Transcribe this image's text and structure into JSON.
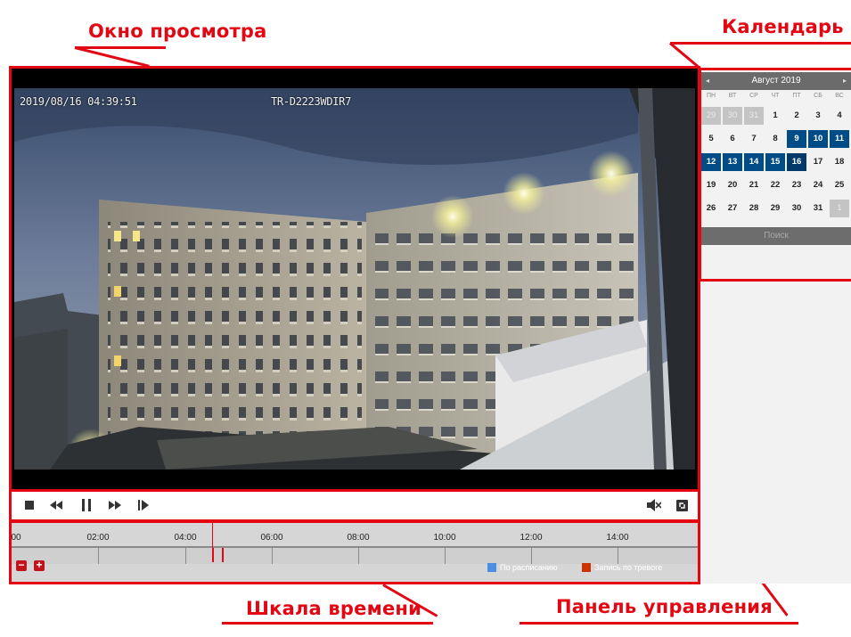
{
  "annotations": {
    "viewer": "Окно просмотра",
    "calendar": "Календарь",
    "timeline": "Шкала времени",
    "control_panel": "Панель управления"
  },
  "video": {
    "timestamp": "2019/08/16 04:39:51",
    "camera_name": "TR-D2223WDIR7"
  },
  "controls": {
    "buttons": [
      "stop-icon",
      "rewind-icon",
      "pause-icon",
      "fast-forward-icon",
      "step-forward-icon"
    ],
    "right_buttons": [
      "mute-icon",
      "fullscreen-icon"
    ]
  },
  "timeline": {
    "ticks": [
      "00",
      "02:00",
      "04:00",
      "06:00",
      "08:00",
      "10:00",
      "12:00",
      "14:00"
    ],
    "zoom_out": "−",
    "zoom_in": "+",
    "legend": [
      {
        "label": "По расписанию",
        "color": "#4a90e2"
      },
      {
        "label": "Запись по тревоге",
        "color": "#cc3300"
      }
    ],
    "cursor_color": "#e30613"
  },
  "calendar": {
    "month": "Август 2019",
    "prev": "◂",
    "next": "▸",
    "weekdays": [
      "ПН",
      "ВТ",
      "СР",
      "ЧТ",
      "ПТ",
      "СБ",
      "ВС"
    ],
    "weeks": [
      [
        {
          "d": "29",
          "t": "other"
        },
        {
          "d": "30",
          "t": "other"
        },
        {
          "d": "31",
          "t": "other"
        },
        {
          "d": "1"
        },
        {
          "d": "2"
        },
        {
          "d": "3"
        },
        {
          "d": "4"
        }
      ],
      [
        {
          "d": "5"
        },
        {
          "d": "6"
        },
        {
          "d": "7"
        },
        {
          "d": "8"
        },
        {
          "d": "9",
          "t": "rec"
        },
        {
          "d": "10",
          "t": "rec"
        },
        {
          "d": "11",
          "t": "rec"
        }
      ],
      [
        {
          "d": "12",
          "t": "rec"
        },
        {
          "d": "13",
          "t": "rec"
        },
        {
          "d": "14",
          "t": "rec"
        },
        {
          "d": "15",
          "t": "rec"
        },
        {
          "d": "16",
          "t": "sel"
        },
        {
          "d": "17"
        },
        {
          "d": "18"
        }
      ],
      [
        {
          "d": "19"
        },
        {
          "d": "20"
        },
        {
          "d": "21"
        },
        {
          "d": "22"
        },
        {
          "d": "23"
        },
        {
          "d": "24"
        },
        {
          "d": "25"
        }
      ],
      [
        {
          "d": "26"
        },
        {
          "d": "27"
        },
        {
          "d": "28"
        },
        {
          "d": "29"
        },
        {
          "d": "30"
        },
        {
          "d": "31"
        },
        {
          "d": "1",
          "t": "other"
        }
      ]
    ],
    "search_label": "Поиск",
    "colors": {
      "recorded": "#004c86",
      "selected": "#003a6b"
    }
  }
}
